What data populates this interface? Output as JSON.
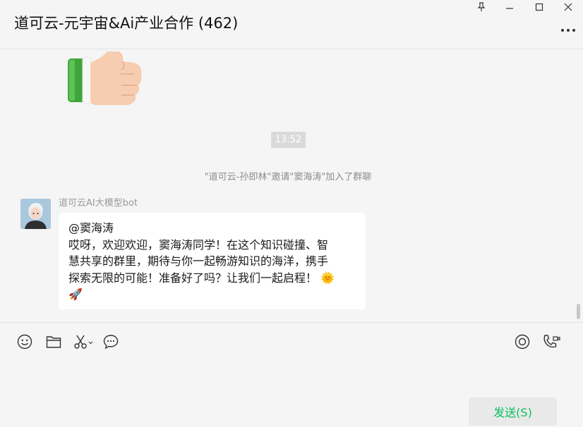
{
  "header": {
    "title": "道可云-元宇宙&Ai产业合作 (462)"
  },
  "chat": {
    "time": "13:52",
    "system_message": "\"道可云-孙即林\"邀请\"窦海涛\"加入了群聊",
    "message": {
      "sender": "道可云AI大模型bot",
      "lines": [
        "@窦海涛",
        "哎呀，欢迎欢迎，窦海涛同学！在这个知识碰撞、智",
        "慧共享的群里，期待与你一起畅游知识的海洋，携手",
        "探索无限的可能！准备好了吗？让我们一起启程！ 🌞",
        "🚀"
      ]
    }
  },
  "input": {
    "send_label": "发送(S)"
  },
  "icons": {
    "pin": "pin-icon",
    "minimize": "minimize-icon",
    "maximize": "maximize-icon",
    "close": "close-icon",
    "more": "more-icon",
    "emoji": "emoji-icon",
    "folder": "folder-icon",
    "scissors": "scissors-icon",
    "chat_history": "chat-bubble-icon",
    "live": "live-icon",
    "call": "call-icon"
  },
  "colors": {
    "accent": "#07c160",
    "background": "#f5f5f5",
    "bubble": "#ffffff"
  }
}
